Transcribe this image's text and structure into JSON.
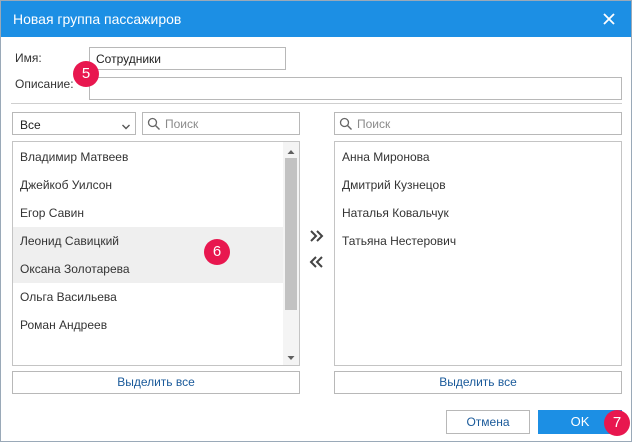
{
  "dialog": {
    "title": "Новая группа пассажиров",
    "close_icon": "close-icon",
    "colors": {
      "titlebar": "#1c8fe4",
      "badge": "#e8174f",
      "ok_button": "#1c8fe4"
    }
  },
  "form": {
    "name_label": "Имя:",
    "name_value": "Сотрудники",
    "description_label": "Описание:",
    "description_value": ""
  },
  "left": {
    "filter_value": "Все",
    "search_placeholder": "Поиск",
    "items": [
      "Владимир Матвеев",
      "Джейкоб Уилсон",
      "Егор Савин",
      "Леонид Савицкий",
      "Оксана Золотарева",
      "Ольга Васильева",
      "Роман Андреев"
    ],
    "select_all_label": "Выделить все"
  },
  "right": {
    "search_placeholder": "Поиск",
    "items": [
      "Анна Миронова",
      "Дмитрий Кузнецов",
      "Наталья Ковальчук",
      "Татьяна Нестерович"
    ],
    "select_all_label": "Выделить все"
  },
  "buttons": {
    "cancel_label": "Отмена",
    "ok_label": "OK"
  },
  "badges": [
    "5",
    "6",
    "7"
  ]
}
